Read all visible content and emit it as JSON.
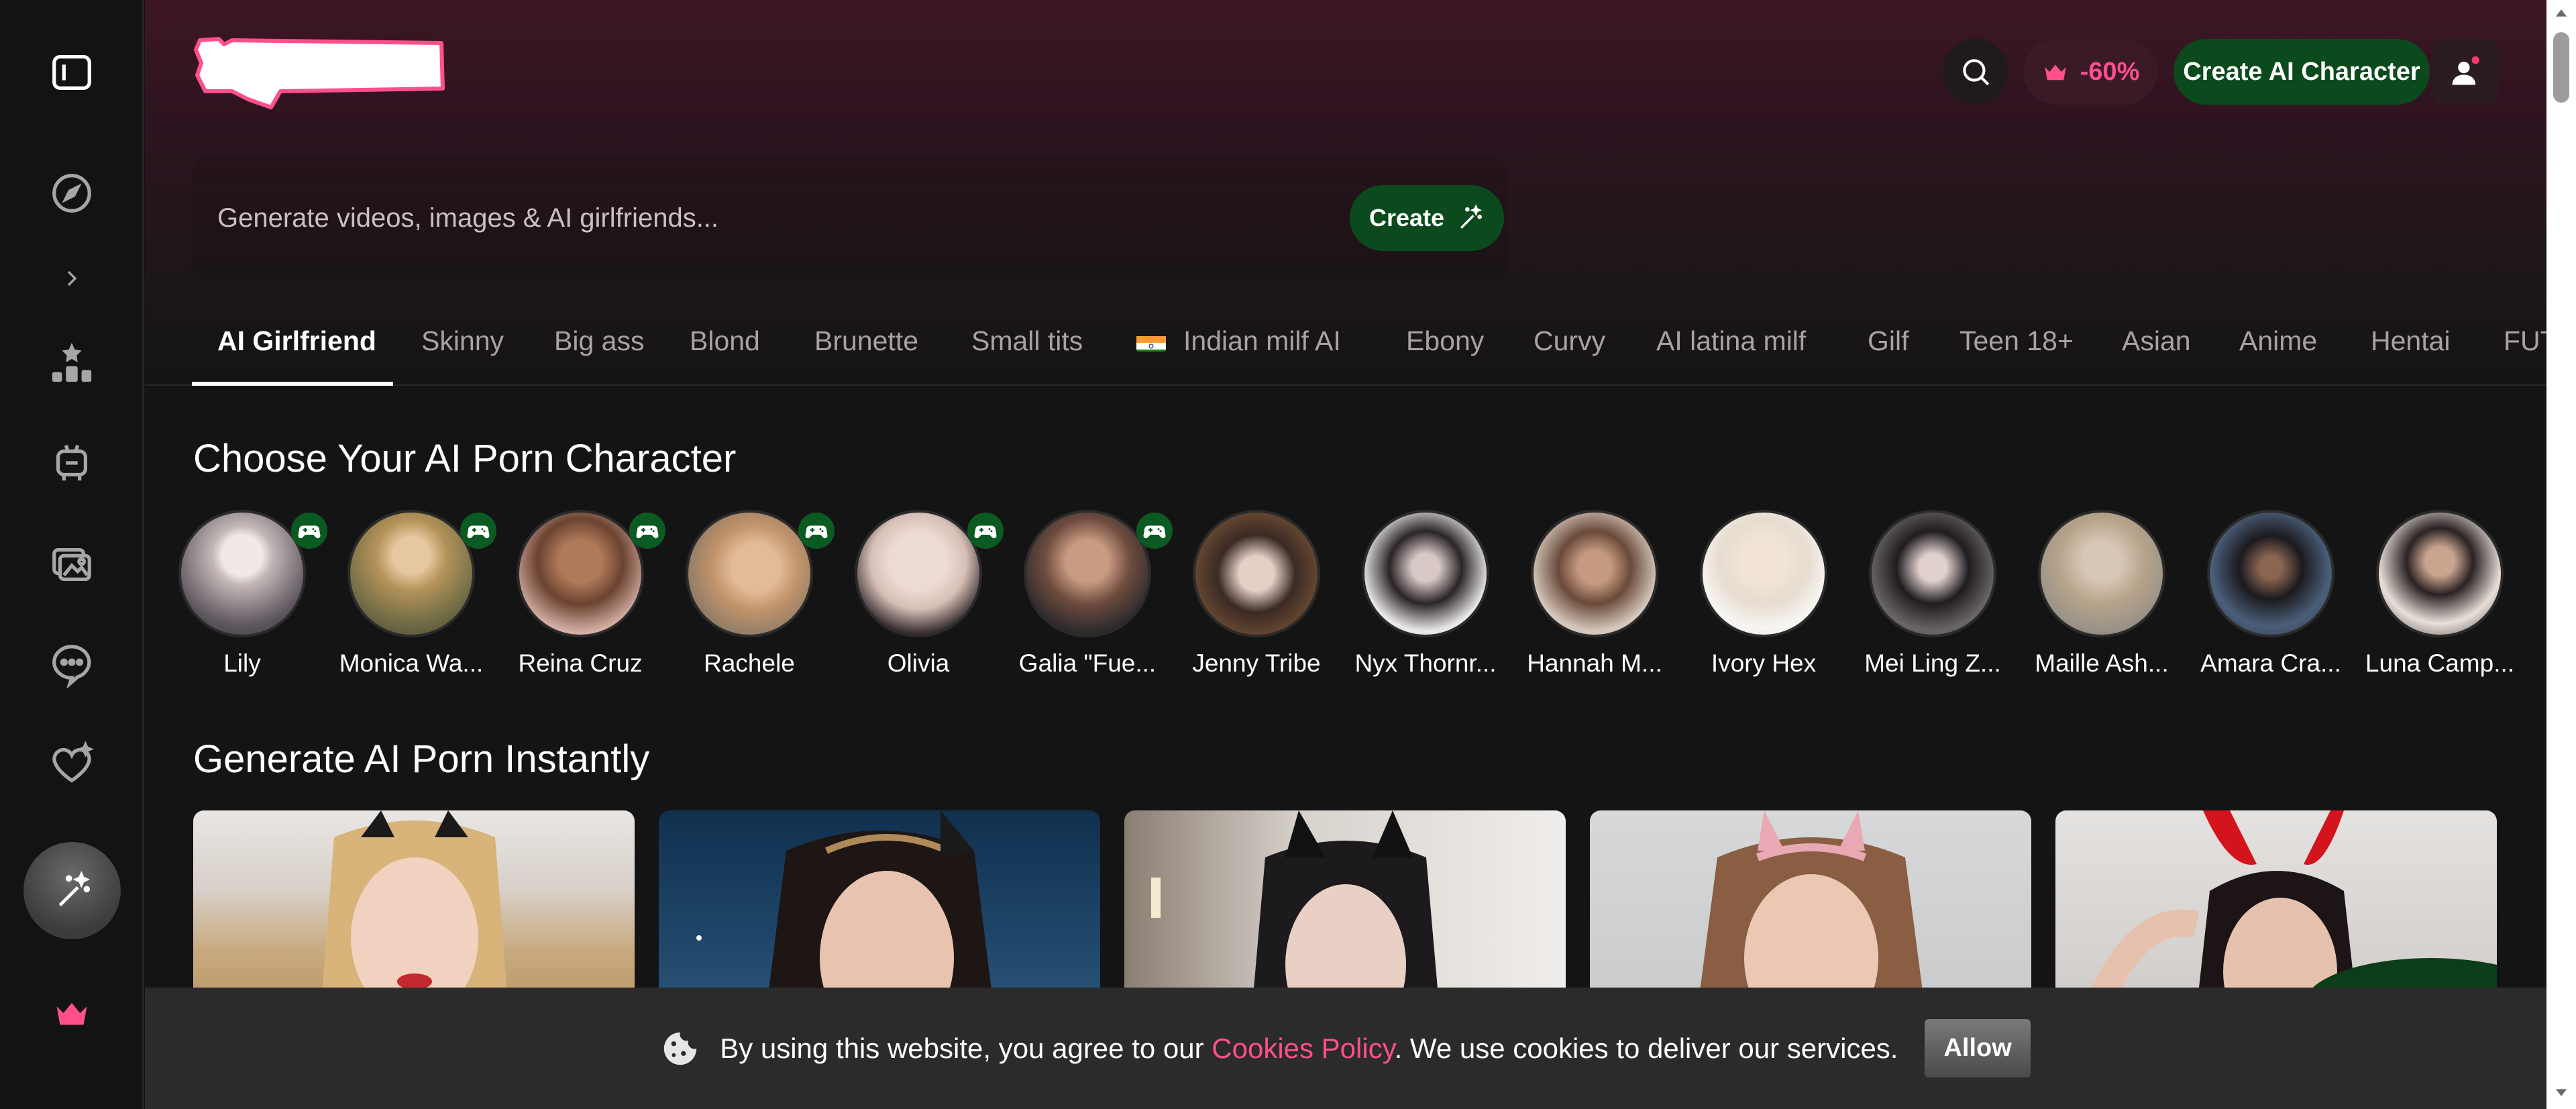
{
  "sidebar": {
    "items": [
      {
        "icon": "sidebar-toggle-icon"
      },
      {
        "icon": "compass-icon"
      },
      {
        "icon": "chevron-right-icon"
      },
      {
        "icon": "ranking-icon"
      },
      {
        "icon": "robot-icon"
      },
      {
        "icon": "gallery-icon"
      },
      {
        "icon": "chat-icon"
      },
      {
        "icon": "heart-sparkle-icon"
      },
      {
        "icon": "magic-wand-icon"
      },
      {
        "icon": "crown-icon"
      }
    ]
  },
  "header": {
    "promo_label": "-60%",
    "create_character_label": "Create AI Character"
  },
  "prompt": {
    "placeholder": "Generate videos, images & AI girlfriends...",
    "create_label": "Create"
  },
  "tabs": [
    "AI Girlfriend",
    "Skinny",
    "Big ass",
    "Blond",
    "Brunette",
    "Small tits",
    "Indian milf AI",
    "Ebony",
    "Curvy",
    "AI latina milf",
    "Gilf",
    "Teen 18+",
    "Asian",
    "Anime",
    "Hentai",
    "FUT"
  ],
  "characters_section": {
    "title": "Choose Your AI Porn Character",
    "characters": [
      {
        "name": "Lily",
        "game": true
      },
      {
        "name": "Monica Wa...",
        "game": true
      },
      {
        "name": "Reina Cruz",
        "game": true
      },
      {
        "name": "Rachele",
        "game": true
      },
      {
        "name": "Olivia",
        "game": true
      },
      {
        "name": "Galia \"Fue...",
        "game": true
      },
      {
        "name": "Jenny Tribe",
        "game": false
      },
      {
        "name": "Nyx Thornr...",
        "game": false
      },
      {
        "name": "Hannah M...",
        "game": false
      },
      {
        "name": "Ivory Hex",
        "game": false
      },
      {
        "name": "Mei Ling Z...",
        "game": false
      },
      {
        "name": "Maille Ash...",
        "game": false
      },
      {
        "name": "Amara Cra...",
        "game": false
      },
      {
        "name": "Luna Camp...",
        "game": false
      }
    ]
  },
  "generate_section": {
    "title": "Generate AI Porn Instantly"
  },
  "cookie_banner": {
    "text_before": "By using this website, you agree to our",
    "link": "Cookies Policy",
    "text_after": ". We use cookies to deliver our services.",
    "allow_label": "Allow"
  },
  "colors": {
    "accent_pink": "#ff4f8d",
    "accent_green": "#0b4a1c"
  }
}
